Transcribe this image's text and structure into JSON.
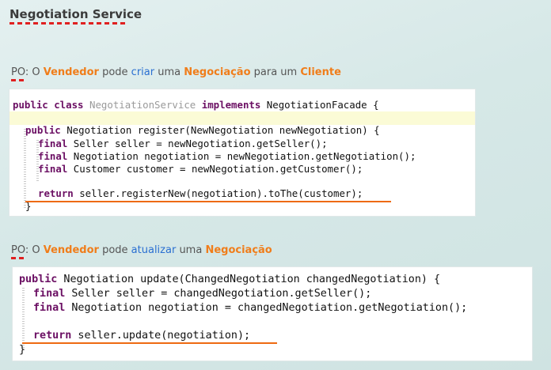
{
  "header": {
    "title": "Negotiation Service"
  },
  "po1": {
    "prefix": "PO",
    "colon": ": O ",
    "actor": "Vendedor",
    "pode": " pode ",
    "verb": "criar",
    "uma": " uma ",
    "object": "Negociação",
    "para": " para um ",
    "target": "Cliente"
  },
  "code1": {
    "l1_kw": "public class",
    "l1_name": " NegotiationService ",
    "l1_kw2": "implements",
    "l1_rest": " NegotiationFacade {",
    "l2_kw": "public",
    "l2_rest": " Negotiation register(NewNegotiation newNegotiation) {",
    "l3_kw": "final",
    "l3_rest": " Seller seller = newNegotiation.getSeller();",
    "l4_kw": "final",
    "l4_rest": " Negotiation negotiation = newNegotiation.getNegotiation();",
    "l5_kw": "final",
    "l5_rest": " Customer customer = newNegotiation.getCustomer();",
    "l6_kw": "return",
    "l6_rest": " seller.registerNew(negotiation).toThe(customer);",
    "l7": "}"
  },
  "po2": {
    "prefix": "PO",
    "colon": ": O ",
    "actor": "Vendedor",
    "pode": " pode ",
    "verb": "atualizar",
    "uma": " uma ",
    "object": "Negociação"
  },
  "code2": {
    "l1_kw": "public",
    "l1_rest": " Negotiation update(ChangedNegotiation changedNegotiation) {",
    "l2_kw": "final",
    "l2_rest": " Seller seller = changedNegotiation.getSeller();",
    "l3_kw": "final",
    "l3_rest": " Negotiation negotiation = changedNegotiation.getNegotiation();",
    "l4_kw": "return",
    "l4_rest": " seller.update(negotiation);",
    "l5": "}"
  }
}
